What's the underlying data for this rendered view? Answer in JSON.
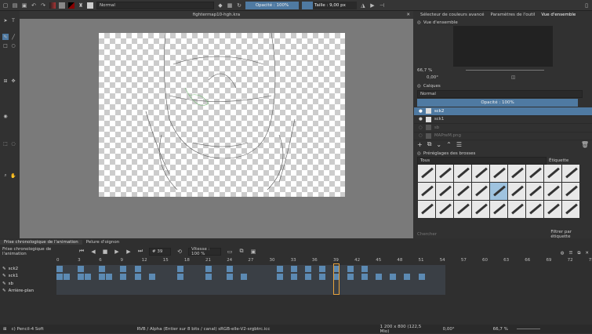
{
  "toolbar": {
    "blend_mode": "Normal",
    "opacity": "Opacité : 100%",
    "size": "Taille : 9,00 px"
  },
  "document": {
    "title": "fightermap10-hgh.kra"
  },
  "dock_tabs": [
    "Sélecteur de couleurs avancé",
    "Paramètres de l'outil",
    "Vue d'ensemble"
  ],
  "overview": {
    "title": "Vue d'ensemble",
    "zoom": "66,7 %",
    "rotation": "0,00°"
  },
  "layers": {
    "title": "Calques",
    "blend_mode": "Normal",
    "opacity": "Opacité : 100%",
    "items": [
      {
        "name": "sck2",
        "selected": true
      },
      {
        "name": "sck1",
        "selected": false
      },
      {
        "name": "sb",
        "selected": false
      },
      {
        "name": "MAPreM.png",
        "selected": false
      }
    ]
  },
  "brushes": {
    "title": "Préréglages des brosses",
    "filter": "Tous",
    "tag_label": "Étiquette",
    "search_placeholder": "Chercher",
    "filter_tag": "Filtrer par étiquette"
  },
  "timeline": {
    "tabs": [
      "Frise chronologique de l'animation",
      "Pelure d'oignon"
    ],
    "title": "Frise chronologique de l'animation",
    "frame": "# 39",
    "speed": "Vitesse : 100 %",
    "current_frame": 39,
    "ruler": [
      "0",
      "3",
      "6",
      "9",
      "12",
      "15",
      "18",
      "21",
      "24",
      "27",
      "30",
      "33",
      "36",
      "39",
      "42",
      "45",
      "48",
      "51",
      "54",
      "57",
      "60",
      "63",
      "66",
      "69",
      "72",
      "75"
    ],
    "layers": [
      {
        "name": "sck2",
        "keys": [
          0,
          3,
          6,
          9,
          11,
          17,
          21,
          24,
          31,
          33,
          35,
          37,
          39,
          41,
          43
        ]
      },
      {
        "name": "sck1",
        "keys": [
          0,
          1,
          3,
          4,
          6,
          7,
          9,
          11,
          13,
          17,
          21,
          24,
          26,
          31,
          33,
          35,
          37,
          39,
          41,
          43,
          45,
          47,
          49,
          51
        ]
      },
      {
        "name": "sb",
        "keys": []
      },
      {
        "name": "Arrière-plan",
        "keys": []
      }
    ]
  },
  "status": {
    "brush": "c) Pencil-4 Soft",
    "color_space": "RVB / Alpha (Entier sur 8 bits / canal) sRGB-elle-V2-srgbtrc.icc",
    "dimensions": "1 200 x 800 (122,5 Mio)",
    "rotation": "0,00°",
    "zoom": "66,7 %"
  }
}
